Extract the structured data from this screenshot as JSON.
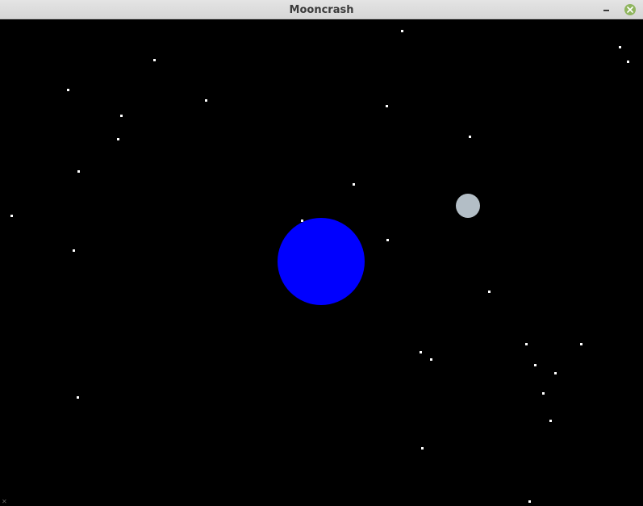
{
  "window": {
    "title": "Mooncrash",
    "minimize_icon": "minimize-icon",
    "close_icon": "close-icon",
    "close_color": "#8fb55e"
  },
  "scene": {
    "background_color": "#000000",
    "planet_color": "#0000ff",
    "moon_color": "#b3bec6",
    "star_color": "#ffffff"
  }
}
